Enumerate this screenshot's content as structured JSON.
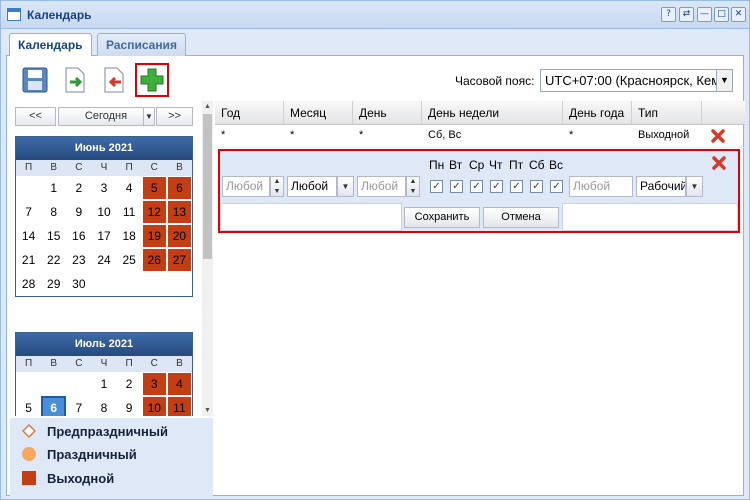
{
  "window": {
    "title": "Календарь",
    "buttons": [
      "?",
      "⇄",
      "—",
      "□",
      "✕"
    ]
  },
  "tabs": [
    {
      "label": "Календарь",
      "active": true
    },
    {
      "label": "Расписания",
      "active": false
    }
  ],
  "toolbar": {
    "timezone_label": "Часовой пояс:",
    "timezone_value": "UTC+07:00 (Красноярск, Кеме",
    "buttons": [
      "save-icon",
      "import-icon",
      "export-icon",
      "add-icon"
    ]
  },
  "calendar_nav": {
    "prev": "<<",
    "today": "Сегодня",
    "next": ">>"
  },
  "weekdays": [
    "П",
    "В",
    "С",
    "Ч",
    "П",
    "С",
    "В"
  ],
  "months": [
    {
      "title": "Июнь 2021",
      "rows": [
        [
          "",
          "1",
          "2",
          "3",
          "4",
          "5",
          "6"
        ],
        [
          "7",
          "8",
          "9",
          "10",
          "11",
          "12",
          "13"
        ],
        [
          "14",
          "15",
          "16",
          "17",
          "18",
          "19",
          "20"
        ],
        [
          "21",
          "22",
          "23",
          "24",
          "25",
          "26",
          "27"
        ],
        [
          "28",
          "29",
          "30",
          "",
          "",
          "",
          ""
        ]
      ]
    },
    {
      "title": "Июль 2021",
      "rows": [
        [
          "",
          "",
          "",
          "1",
          "2",
          "3",
          "4"
        ],
        [
          "5",
          "6",
          "7",
          "8",
          "9",
          "10",
          "11"
        ]
      ]
    }
  ],
  "legend": [
    {
      "label": "Предпраздничный",
      "color": "#e07a3a"
    },
    {
      "label": "Праздничный",
      "color": "#f5a862"
    },
    {
      "label": "Выходной",
      "color": "#c33e14"
    }
  ],
  "grid": {
    "columns": [
      "Год",
      "Месяц",
      "День",
      "День недели",
      "День года",
      "Тип"
    ],
    "rows": [
      {
        "year": "*",
        "month": "*",
        "day": "*",
        "weekday": "Сб, Вс",
        "yearday": "*",
        "type": "Выходной"
      }
    ]
  },
  "editor": {
    "year_placeholder": "Любой",
    "month_value": "Любой",
    "day_placeholder": "Любой",
    "day_names": [
      "Пн",
      "Вт",
      "Ср",
      "Чт",
      "Пт",
      "Сб",
      "Вс"
    ],
    "yearday_placeholder": "Любой",
    "type_value": "Рабочий",
    "save_label": "Сохранить",
    "cancel_label": "Отмена"
  },
  "colors": {
    "accent": "#15428b",
    "highlight": "#e00000",
    "holiday": "#c33e14",
    "today": "#4a8ed6"
  }
}
